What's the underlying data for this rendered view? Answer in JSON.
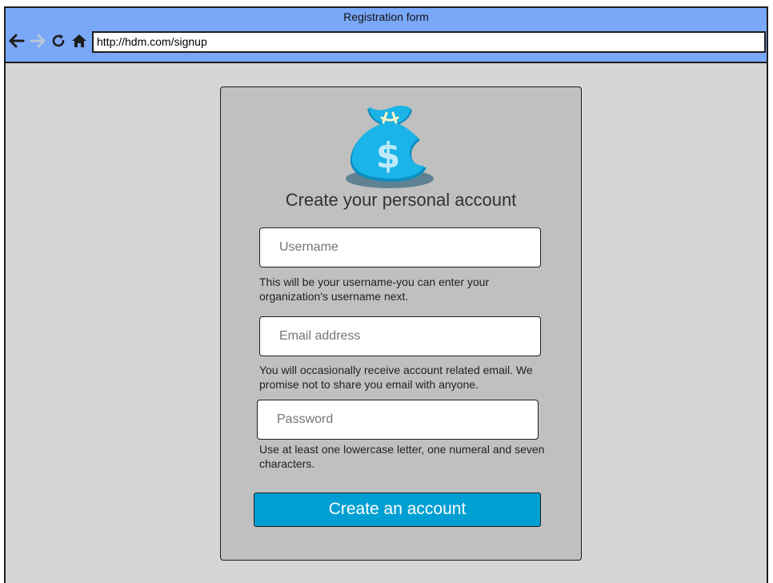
{
  "window": {
    "title": "Registration form"
  },
  "browser": {
    "url": "http://hdm.com/signup",
    "icons": [
      "back-arrow-icon",
      "forward-arrow-icon",
      "reload-icon",
      "home-icon"
    ]
  },
  "form": {
    "heading": "Create your personal account",
    "logo_icon": "money-bag-icon",
    "username": {
      "placeholder": "Username",
      "help": "This will be your username-you can enter your organization's username next."
    },
    "email": {
      "placeholder": "Email address",
      "help": "You will occasionally receive account related email. We promise not to share you email with anyone."
    },
    "password": {
      "placeholder": "Password",
      "help": "Use at least one lowercase letter, one numeral and seven characters."
    },
    "submit_label": "Create an account"
  },
  "colors": {
    "titlebar": "#7aa8f9",
    "page_bg": "#d6d6d6",
    "card_bg": "#c0c0c0",
    "button": "#009fd3",
    "bag": "#1ab4e8",
    "forward_disabled": "#b8c6d8"
  }
}
